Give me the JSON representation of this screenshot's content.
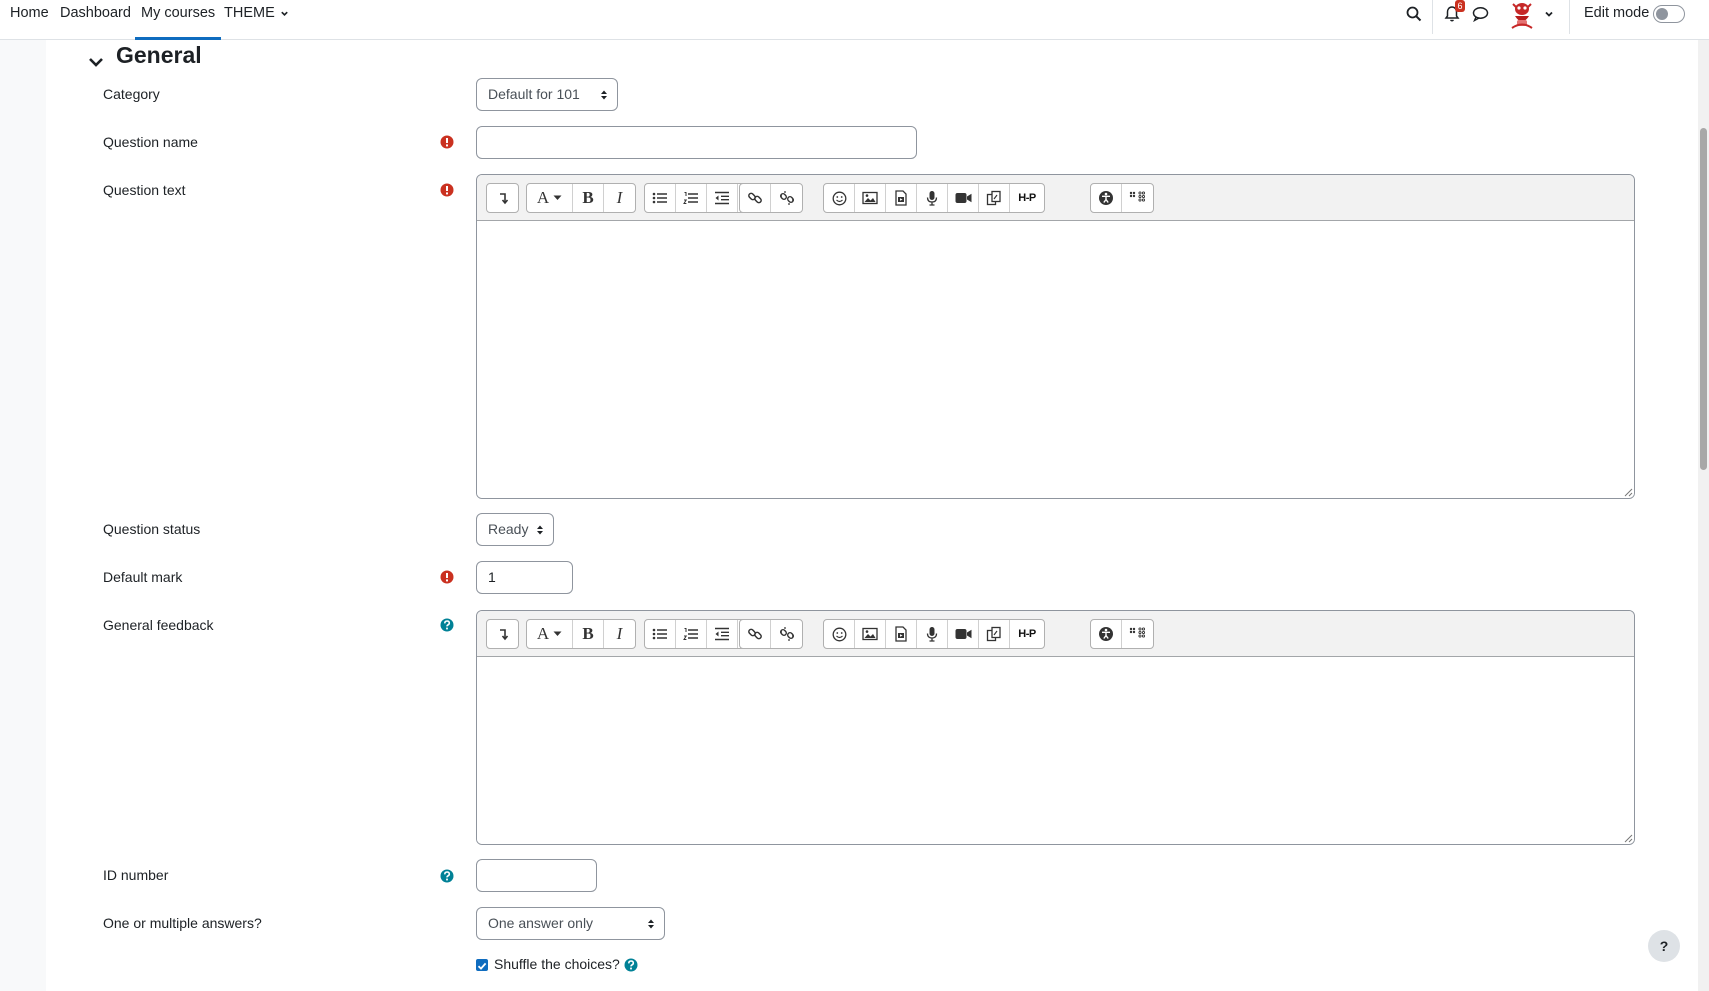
{
  "nav": {
    "links": [
      "Home",
      "Dashboard",
      "My courses",
      "THEME"
    ],
    "notification_count": "6",
    "edit_mode_label": "Edit mode",
    "icons": [
      "search-icon",
      "bell-icon",
      "chat-icon",
      "avatar",
      "chevron-down-icon"
    ]
  },
  "form": {
    "section_title": "General",
    "category": {
      "label": "Category",
      "value": "Default for 101"
    },
    "question_name": {
      "label": "Question name",
      "value": ""
    },
    "question_text": {
      "label": "Question text"
    },
    "question_status": {
      "label": "Question status",
      "value": "Ready"
    },
    "default_mark": {
      "label": "Default mark",
      "value": "1"
    },
    "general_feedback": {
      "label": "General feedback"
    },
    "id_number": {
      "label": "ID number",
      "value": ""
    },
    "answers_mode": {
      "label": "One or multiple answers?",
      "value": "One answer only"
    },
    "shuffle": {
      "label": "Shuffle the choices?",
      "checked": true
    }
  },
  "editor_toolbar": [
    [
      "collapse-icon"
    ],
    [
      "font-style-icon",
      "bold-icon",
      "italic-icon"
    ],
    [
      "unordered-list-icon",
      "ordered-list-icon",
      "outdent-icon",
      "indent-icon"
    ],
    [
      "link-icon",
      "unlink-icon"
    ],
    [
      "emoji-icon",
      "image-icon",
      "media-icon",
      "record-audio-icon",
      "record-video-icon",
      "manage-files-icon",
      "h5p-icon"
    ],
    [
      "accessibility-checker-icon",
      "screenreader-helper-icon"
    ]
  ],
  "toolbar_text": {
    "font": "A",
    "bold": "B",
    "italic": "I",
    "h5p": "H-P"
  },
  "help_button": "?",
  "colors": {
    "accent": "#0f6cbf",
    "required": "#ca3120",
    "help": "#008196",
    "page_bg": "#f8f9fa"
  }
}
